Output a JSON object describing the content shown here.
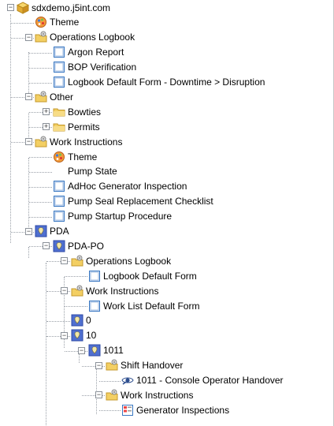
{
  "tree": {
    "nodes": [
      {
        "label": "sdxdemo.j5int.com",
        "icon": "server-cube-icon",
        "level": 0,
        "expanded": true
      },
      {
        "label": "Theme",
        "icon": "theme-palette-icon",
        "level": 1
      },
      {
        "label": "Operations Logbook",
        "icon": "folder-gear-icon",
        "level": 1,
        "expanded": true
      },
      {
        "label": "Argon Report",
        "icon": "form-icon",
        "level": 2
      },
      {
        "label": "BOP Verification",
        "icon": "form-icon",
        "level": 2
      },
      {
        "label": "Logbook Default Form - Downtime > Disruption",
        "icon": "form-icon",
        "level": 2
      },
      {
        "label": "Other",
        "icon": "folder-gear-icon",
        "level": 1,
        "expanded": true
      },
      {
        "label": "Bowties",
        "icon": "folder-icon",
        "level": 2,
        "expanded": false
      },
      {
        "label": "Permits",
        "icon": "folder-icon",
        "level": 2,
        "expanded": false
      },
      {
        "label": "Work Instructions",
        "icon": "folder-gear-icon",
        "level": 1,
        "expanded": true
      },
      {
        "label": "Theme",
        "icon": "theme-palette-icon",
        "level": 2
      },
      {
        "label": "Pump State",
        "icon": "blank-form-icon",
        "level": 2
      },
      {
        "label": "AdHoc Generator Inspection",
        "icon": "form-icon",
        "level": 2
      },
      {
        "label": "Pump Seal Replacement Checklist",
        "icon": "form-icon",
        "level": 2
      },
      {
        "label": "Pump Startup Procedure",
        "icon": "form-icon",
        "level": 2
      },
      {
        "label": "PDA",
        "icon": "pda-location-icon",
        "level": 1,
        "expanded": true
      },
      {
        "label": "PDA-PO",
        "icon": "pda-location-icon",
        "level": 2,
        "expanded": true
      },
      {
        "label": "Operations Logbook",
        "icon": "folder-gear-icon",
        "level": 3,
        "expanded": true
      },
      {
        "label": "Logbook Default Form",
        "icon": "form-icon",
        "level": 4
      },
      {
        "label": "Work Instructions",
        "icon": "folder-gear-icon",
        "level": 3,
        "expanded": true
      },
      {
        "label": "Work List Default Form",
        "icon": "form-icon",
        "level": 4
      },
      {
        "label": "0",
        "icon": "pda-location-icon",
        "level": 3
      },
      {
        "label": "10",
        "icon": "pda-location-icon",
        "level": 3,
        "expanded": true
      },
      {
        "label": "1011",
        "icon": "pda-location-icon",
        "level": 4,
        "expanded": true
      },
      {
        "label": "Shift Handover",
        "icon": "folder-gear-icon",
        "level": 5,
        "expanded": true
      },
      {
        "label": "1011 - Console Operator Handover",
        "icon": "handover-eye-icon",
        "level": 6
      },
      {
        "label": "Work Instructions",
        "icon": "folder-gear-icon",
        "level": 5,
        "expanded": true
      },
      {
        "label": "Generator Inspections",
        "icon": "checklist-form-icon",
        "level": 6
      }
    ]
  },
  "colors": {
    "connector": "#9aa0a8",
    "folder": "#f3cf63",
    "form_blue": "#3a78c2",
    "pda_blue": "#4f6fd0"
  }
}
